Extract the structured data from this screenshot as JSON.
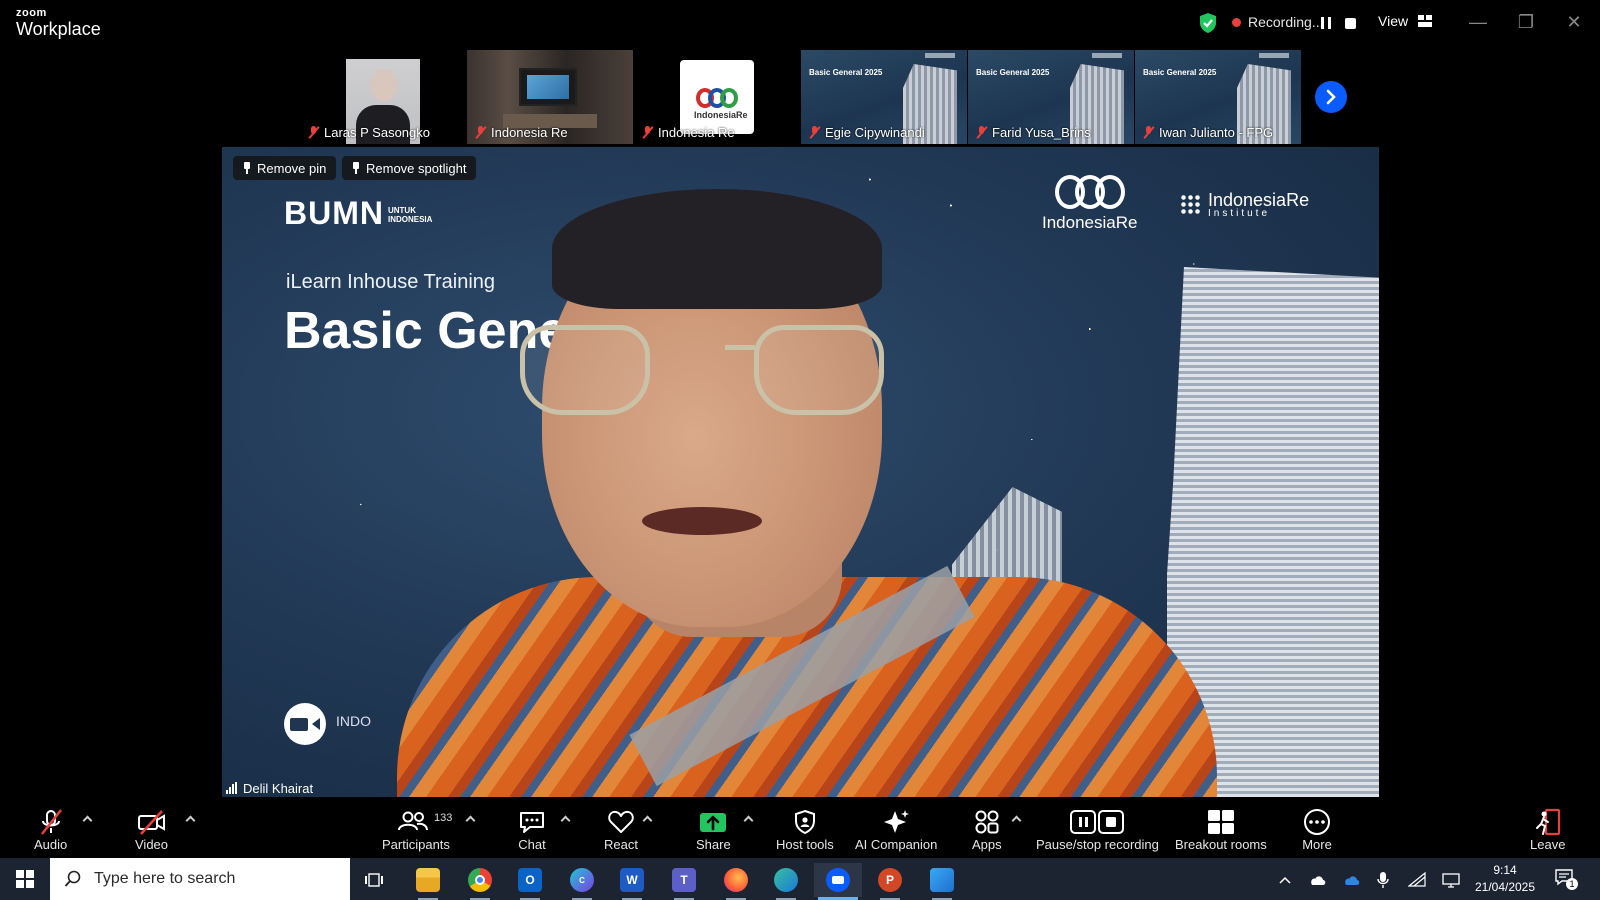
{
  "app": {
    "logo_top": "zoom",
    "logo_bottom": "Workplace",
    "recording_label": "Recording...",
    "view_label": "View"
  },
  "thumbnails": [
    {
      "name": "Laras P Sasongko",
      "muted": true
    },
    {
      "name": "Indonesia Re",
      "muted": true
    },
    {
      "name": "Indonesia Re",
      "muted": true,
      "card_text": "IndonesiaRe"
    },
    {
      "name": "Egie Cipywinandi",
      "muted": true,
      "slide_title": "Basic General 2025"
    },
    {
      "name": "Farid Yusa_Brins",
      "muted": true,
      "slide_title": "Basic General 2025"
    },
    {
      "name": "Iwan Julianto - FPG",
      "muted": true,
      "slide_title": "Basic General 2025"
    }
  ],
  "main_video": {
    "speaker_name": "Delil Khairat",
    "remove_pin_label": "Remove pin",
    "remove_spotlight_label": "Remove spotlight",
    "background": {
      "bumn_text": "BUMN",
      "bumn_small_line1": "UNTUK",
      "bumn_small_line2": "INDONESIA",
      "subtitle": "iLearn Inhouse Training",
      "headline": "Basic Gene",
      "ire_logo_text": "IndonesiaRe",
      "institute_name": "IndonesiaRe",
      "institute_sub": "Institute",
      "bottom_text": "INDO"
    }
  },
  "toolbar": {
    "audio": "Audio",
    "video": "Video",
    "participants": "Participants",
    "participants_count": "133",
    "chat": "Chat",
    "react": "React",
    "share": "Share",
    "host_tools": "Host tools",
    "ai_companion": "AI Companion",
    "apps": "Apps",
    "pause_stop_recording": "Pause/stop recording",
    "breakout_rooms": "Breakout rooms",
    "more": "More",
    "leave": "Leave"
  },
  "taskbar": {
    "search_placeholder": "Type here to search",
    "time": "9:14",
    "date": "21/04/2025",
    "notification_count": "1",
    "apps": [
      "task-view",
      "file-explorer",
      "chrome",
      "outlook",
      "canva",
      "word",
      "teams",
      "firefox",
      "edge",
      "zoom",
      "powerpoint",
      "photos"
    ]
  },
  "colors": {
    "accent_blue": "#0b5cff",
    "record_red": "#e8413d",
    "share_green": "#22c55e",
    "muted_red": "#e8413d",
    "taskbar_bg": "#1c2331"
  }
}
